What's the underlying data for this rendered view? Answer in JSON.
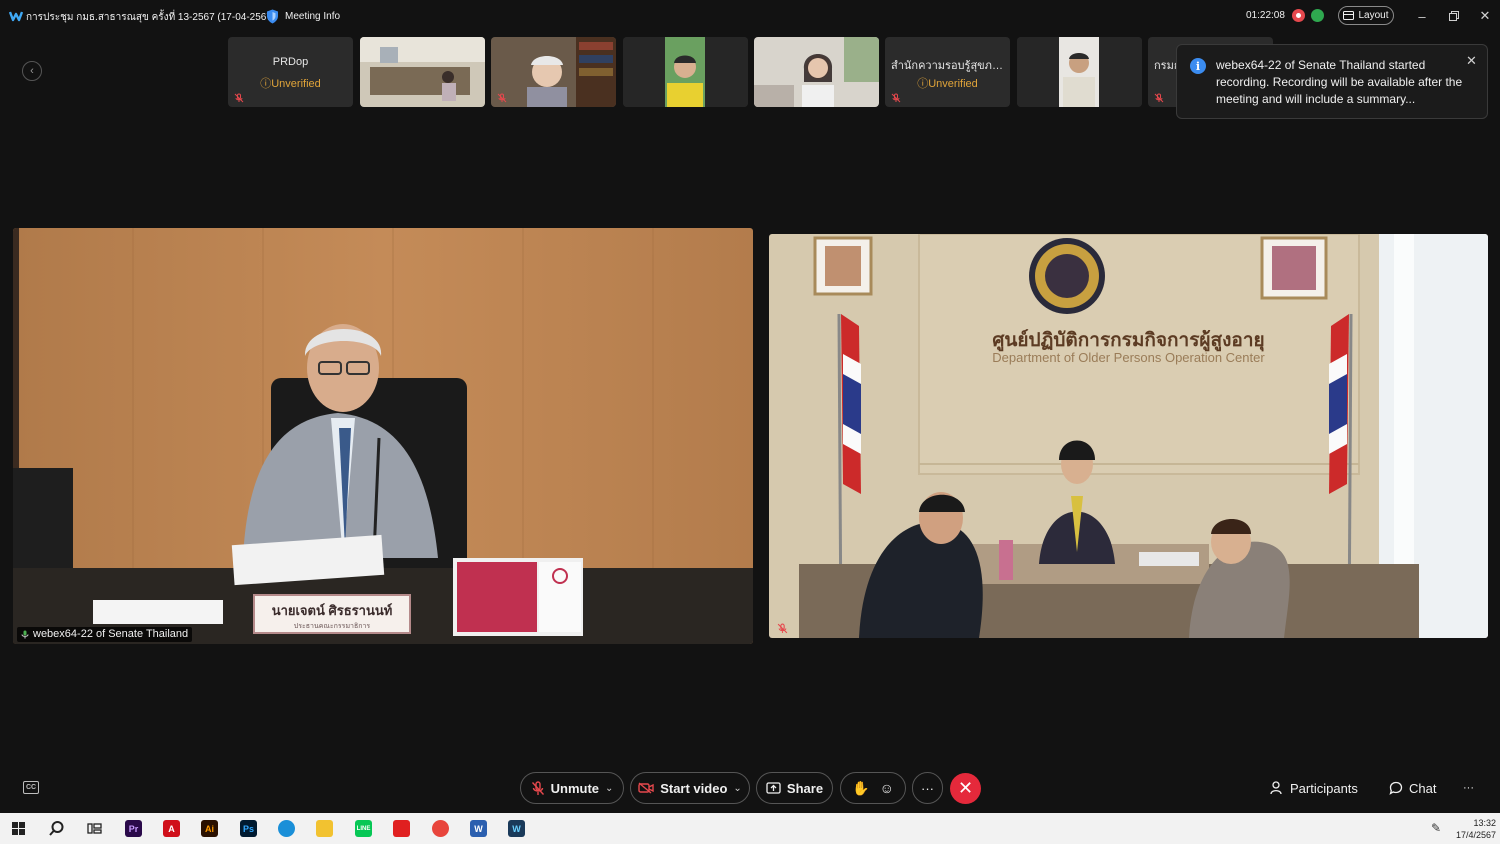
{
  "window": {
    "title": "การประชุม กมธ.สาธารณสุข ครั้งที่ 13-2567 (17-04-2567)",
    "meeting_info_label": "Meeting Info",
    "timer": "01:22:08",
    "layout_label": "Layout"
  },
  "thumbnails": [
    {
      "name": "PRDop",
      "status": "Unverified",
      "type": "avatar"
    },
    {
      "name": "",
      "status": "",
      "type": "video"
    },
    {
      "name": "",
      "status": "",
      "type": "video"
    },
    {
      "name": "",
      "status": "",
      "type": "video"
    },
    {
      "name": "",
      "status": "",
      "type": "video"
    },
    {
      "name": "สำนักความรอบรู้สุขภา...",
      "status": "Unverified",
      "type": "avatar"
    },
    {
      "name": "",
      "status": "",
      "type": "video"
    },
    {
      "name": "กรมก",
      "status": "",
      "type": "avatar"
    }
  ],
  "notification": {
    "message": "webex64-22 of  Senate Thailand started recording. Recording will be available after the meeting and will include a summary..."
  },
  "main_video_left": {
    "name_tag": "webex64-22 of  Senate Thailand",
    "nameplate_line1": "นายเจตน์ ศิรธรานนท์",
    "nameplate_line2": "ประธานคณะกรรมาธิการ"
  },
  "main_video_right": {
    "title_th": "ศูนย์ปฏิบัติการกรมกิจการผู้สูงอายุ",
    "title_en": "Department of Older Persons Operation Center"
  },
  "toolbar": {
    "unmute_label": "Unmute",
    "start_video_label": "Start video",
    "share_label": "Share",
    "participants_label": "Participants",
    "chat_label": "Chat"
  },
  "taskbar": {
    "time": "13:32",
    "date": "17/4/2567"
  },
  "colors": {
    "background": "#121212",
    "end_call": "#e5293b",
    "unverified": "#e0a43a",
    "recording": "#e5484d"
  }
}
